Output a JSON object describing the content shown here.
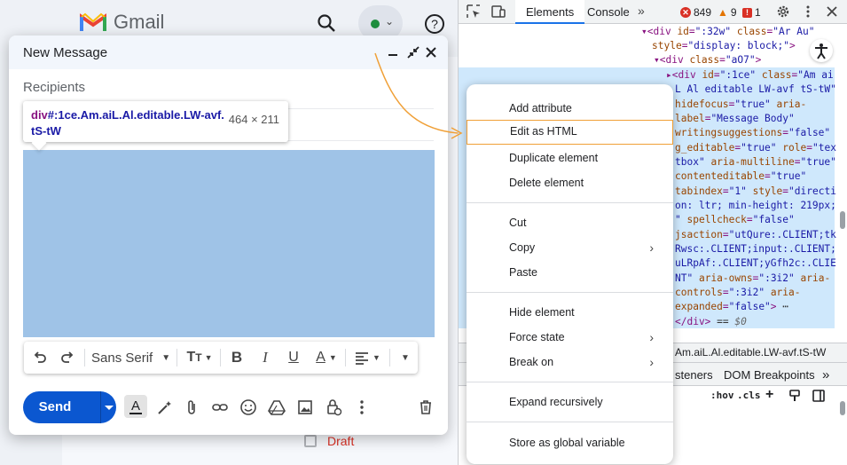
{
  "gmail": {
    "logo_text": "Gmail",
    "draft_label": "Draft"
  },
  "compose": {
    "title": "New Message",
    "recipients_placeholder": "Recipients",
    "tooltip_tag": "div",
    "tooltip_selector": "#:1ce.Am.aiL.Al.editable.LW-avf.",
    "tooltip_selector_2": "tS-tW",
    "tooltip_size": "464 × 211",
    "format_bar": {
      "font_name": "Sans Serif"
    },
    "send_label": "Send"
  },
  "devtools": {
    "tabs": [
      "Elements",
      "Console"
    ],
    "errors_count": "849",
    "warnings_count": "9",
    "info_count": "1",
    "breadcrumb": "Am.aiL.Al.editable.LW-avf.tS-tW",
    "lower_tabs": [
      "steners",
      "DOM Breakpoints"
    ],
    "filter_hov": ":hov",
    "filter_cls": ".cls",
    "colors": {
      "selection": "#cfe8fc",
      "tag": "#881280",
      "attr_name": "#994500",
      "attr_value": "#1a1aa6"
    }
  },
  "context_menu": {
    "items": [
      {
        "label": "Add attribute"
      },
      {
        "label": "Edit as HTML",
        "highlighted": true
      },
      {
        "label": "Duplicate element"
      },
      {
        "label": "Delete element"
      },
      {
        "label": "Cut"
      },
      {
        "label": "Copy",
        "submenu": true
      },
      {
        "label": "Paste"
      },
      {
        "label": "Hide element"
      },
      {
        "label": "Force state",
        "submenu": true
      },
      {
        "label": "Break on",
        "submenu": true
      },
      {
        "label": "Expand recursively"
      },
      {
        "label": "Store as global variable"
      }
    ],
    "highlight_color": "#f0a037"
  }
}
